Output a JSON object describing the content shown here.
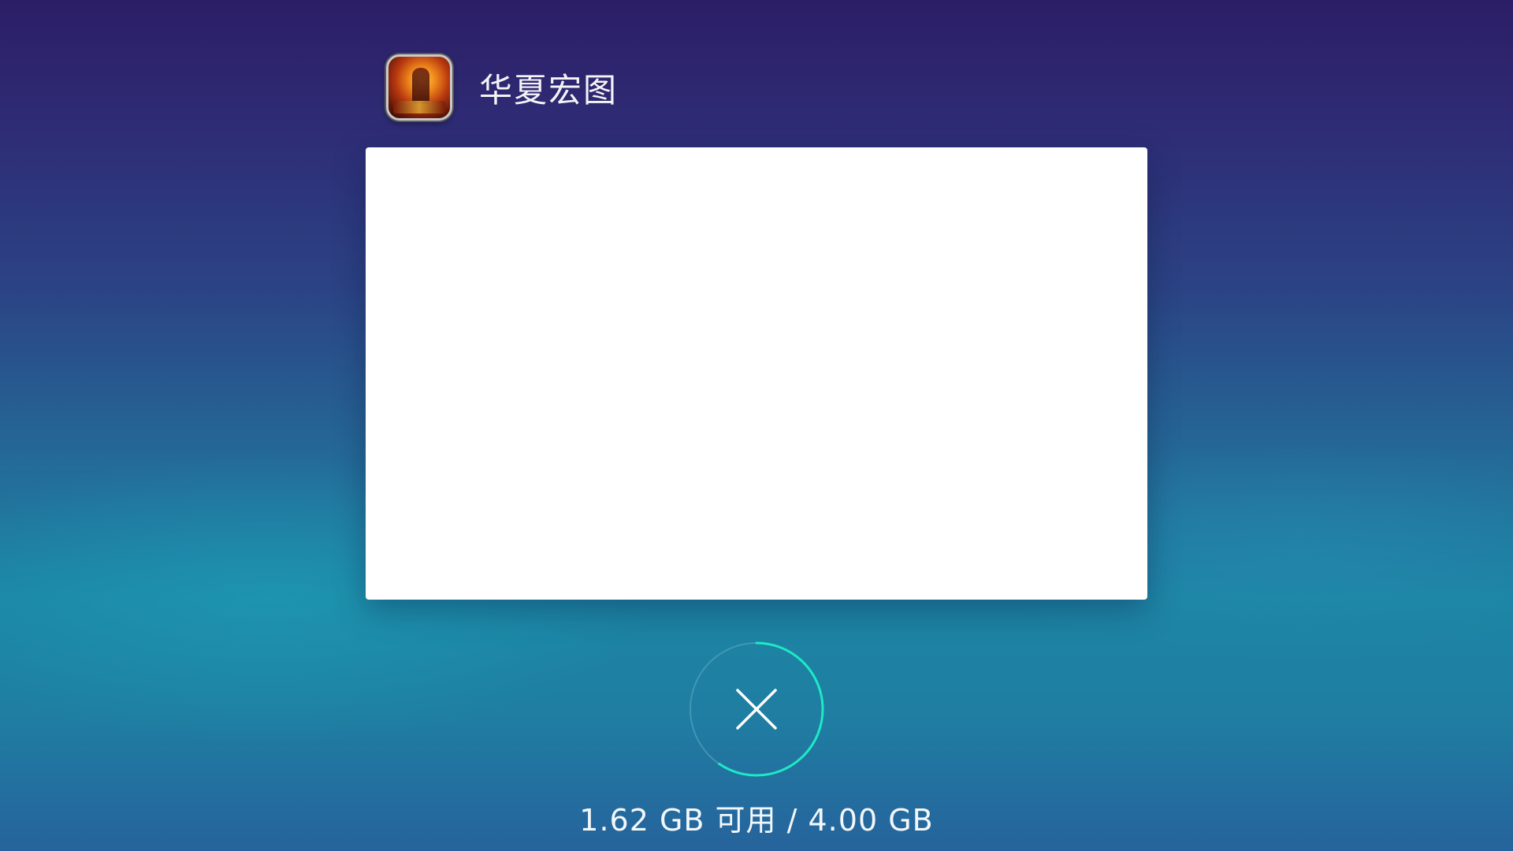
{
  "app": {
    "name": "华夏宏图",
    "icon": "game-app-icon"
  },
  "memory": {
    "available": "1.62 GB",
    "available_label": "可用",
    "separator": "/",
    "total": "4.00 GB",
    "summary": "1.62 GB 可用 / 4.00 GB",
    "used_fraction": 0.595
  },
  "close_button": {
    "icon": "close-icon"
  },
  "colors": {
    "ring_accent": "#1de9c6",
    "ring_track": "#5fa9c2",
    "preview_bg": "#ffffff"
  }
}
